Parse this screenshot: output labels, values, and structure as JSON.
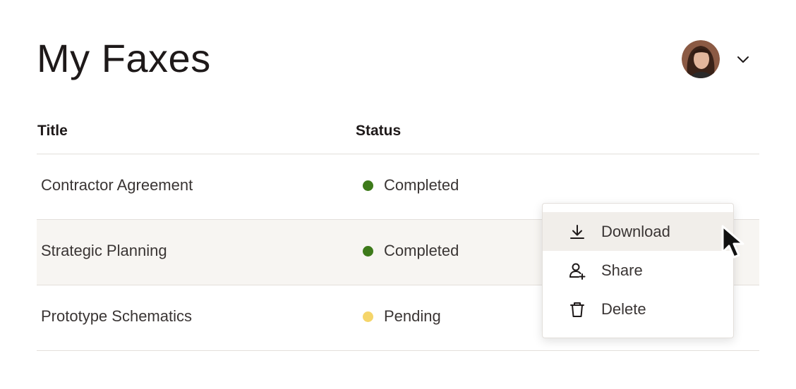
{
  "page": {
    "title": "My Faxes"
  },
  "account": {
    "avatar": "user-avatar",
    "menu_icon": "chevron-down-icon"
  },
  "table": {
    "columns": [
      "Title",
      "Status"
    ],
    "rows": [
      {
        "title": "Contractor Agreement",
        "status": "Completed",
        "status_color": "#3d7a1a"
      },
      {
        "title": "Strategic Planning",
        "status": "Completed",
        "status_color": "#3d7a1a"
      },
      {
        "title": "Prototype Schematics",
        "status": "Pending",
        "status_color": "#f5d56a"
      }
    ]
  },
  "context_menu": {
    "items": [
      {
        "label": "Download",
        "icon": "download-icon"
      },
      {
        "label": "Share",
        "icon": "share-user-icon"
      },
      {
        "label": "Delete",
        "icon": "trash-icon"
      }
    ]
  },
  "colors": {
    "text": "#1e1919",
    "divider": "#e3dfdb",
    "row_hover": "#f7f5f2",
    "menu_hover": "#f1eeea"
  }
}
